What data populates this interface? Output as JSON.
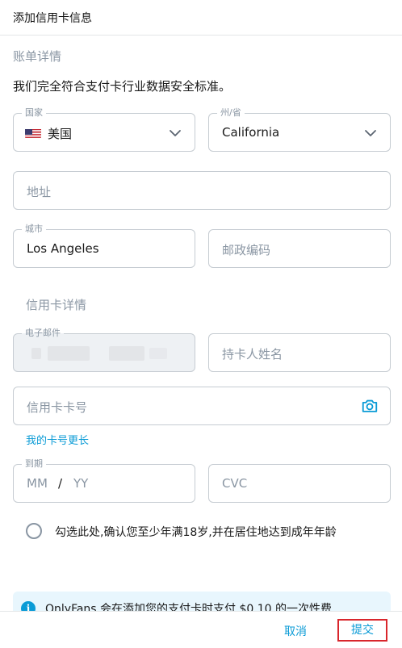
{
  "header": {
    "title": "添加信用卡信息"
  },
  "billing": {
    "section_title": "账单详情",
    "note": "我们完全符合支付卡行业数据安全标准。",
    "country": {
      "label": "国家",
      "value": "美国",
      "icon": "us-flag-icon"
    },
    "state": {
      "label": "州/省",
      "value": "California"
    },
    "address": {
      "placeholder": "地址"
    },
    "city": {
      "label": "城市",
      "value": "Los Angeles"
    },
    "zip": {
      "placeholder": "邮政编码"
    }
  },
  "card": {
    "section_title": "信用卡详情",
    "email": {
      "label": "电子邮件"
    },
    "holder": {
      "placeholder": "持卡人姓名"
    },
    "number": {
      "placeholder": "信用卡卡号",
      "icon": "camera-icon"
    },
    "long_number_link": "我的卡号更长",
    "expiry": {
      "label": "到期",
      "mm": "MM",
      "slash": "/",
      "yy": "YY"
    },
    "cvc": {
      "placeholder": "CVC"
    },
    "age_confirm": "勾选此处,确认您至少年满18岁,并在居住地达到成年年龄"
  },
  "info": {
    "text": "OnlyFans 会在添加您的支付卡时支付 $0.10 的一次性费"
  },
  "footer": {
    "cancel": "取消",
    "submit": "提交"
  },
  "colors": {
    "accent": "#0a9bd6",
    "highlight_border": "#d9262c",
    "muted": "#8a96a3"
  }
}
